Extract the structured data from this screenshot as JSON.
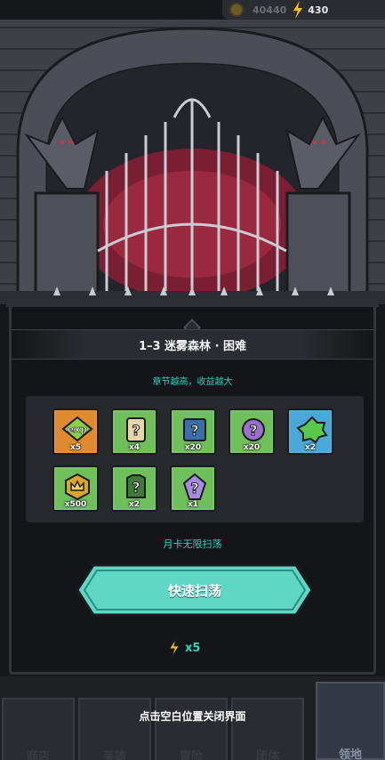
{
  "topbar": {
    "coins": "40440",
    "energy": "430"
  },
  "panel": {
    "title": "1–3 迷雾森林 · 困难",
    "subtitle": "章节越高，收益越大",
    "rewards": [
      {
        "icon": "exp-icon",
        "count": "x5"
      },
      {
        "icon": "mystery-scroll-icon",
        "count": "x4"
      },
      {
        "icon": "mystery-book-icon",
        "count": "x20"
      },
      {
        "icon": "mystery-gear-icon",
        "count": "x20"
      },
      {
        "icon": "green-slime-icon",
        "count": "x2"
      },
      {
        "icon": "crown-coin-icon",
        "count": "x500"
      },
      {
        "icon": "mystery-armor-icon",
        "count": "x2"
      },
      {
        "icon": "mystery-crystal-icon",
        "count": "x1"
      }
    ],
    "monthly_card": "月卡无限扫荡",
    "sweep_button": "快速扫荡",
    "cost": "x5"
  },
  "close_hint": "点击空白位置关闭界面",
  "nav": [
    "商店",
    "英雄",
    "冒险",
    "团体",
    "领地"
  ],
  "colors": {
    "accent": "#2bd4c0",
    "button": "#5fd6c6"
  }
}
